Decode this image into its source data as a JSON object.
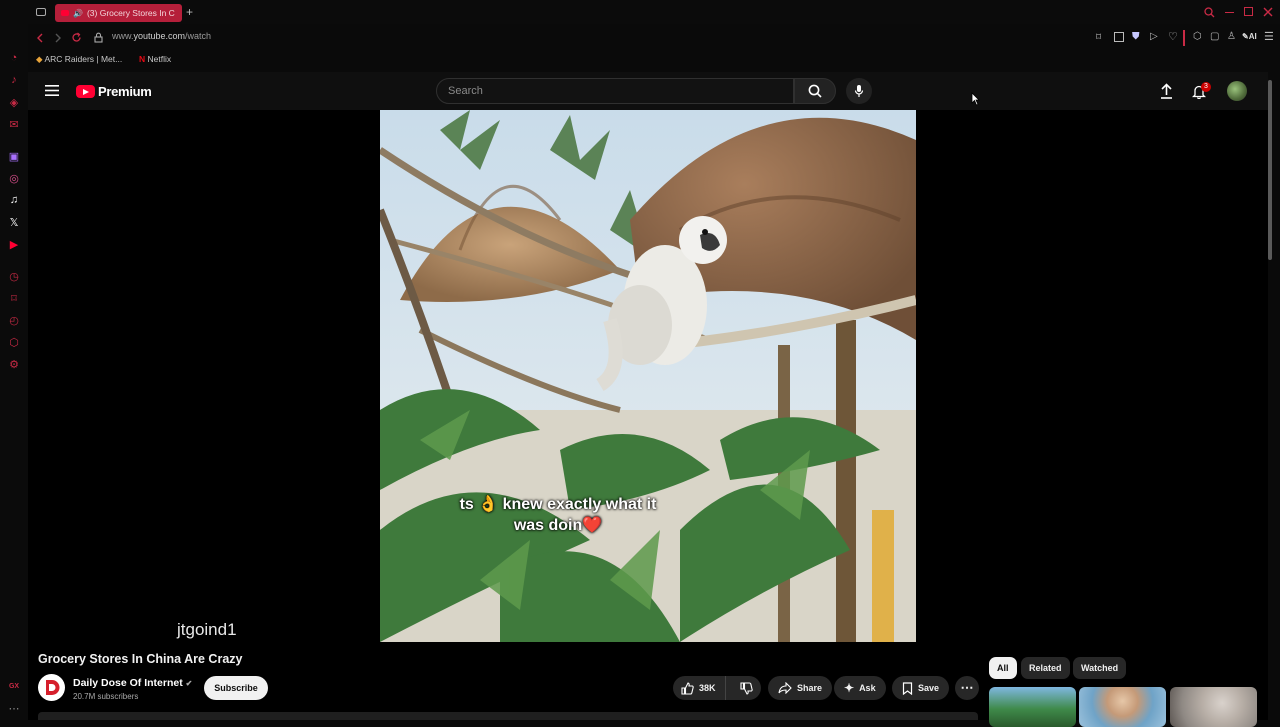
{
  "browser": {
    "tab_title": "(3) Grocery Stores In C",
    "url_prefix": "www.",
    "url_host": "youtube.com",
    "url_path": "/watch",
    "ai_label": "AI",
    "bookmarks": [
      {
        "label": "ARC Raiders | Met..."
      },
      {
        "label": "Netflix"
      }
    ]
  },
  "youtube": {
    "brand": "Premium",
    "search_placeholder": "Search",
    "notification_count": "3",
    "video": {
      "caption_line1": "ts 👌 knew exactly what it",
      "caption_line2": "was doin❤️",
      "watermark": "jtgoind1"
    },
    "title": "Grocery Stores In China Are Crazy",
    "channel": {
      "name": "Daily Dose Of Internet",
      "subscribers": "20.7M subscribers",
      "subscribe_label": "Subscribe"
    },
    "actions": {
      "likes": "38K",
      "share": "Share",
      "ask": "Ask",
      "save": "Save"
    },
    "chips": [
      "All",
      "Related",
      "Watched"
    ]
  },
  "colors": {
    "opera_accent": "#c92a45",
    "youtube_red": "#ff0033"
  }
}
